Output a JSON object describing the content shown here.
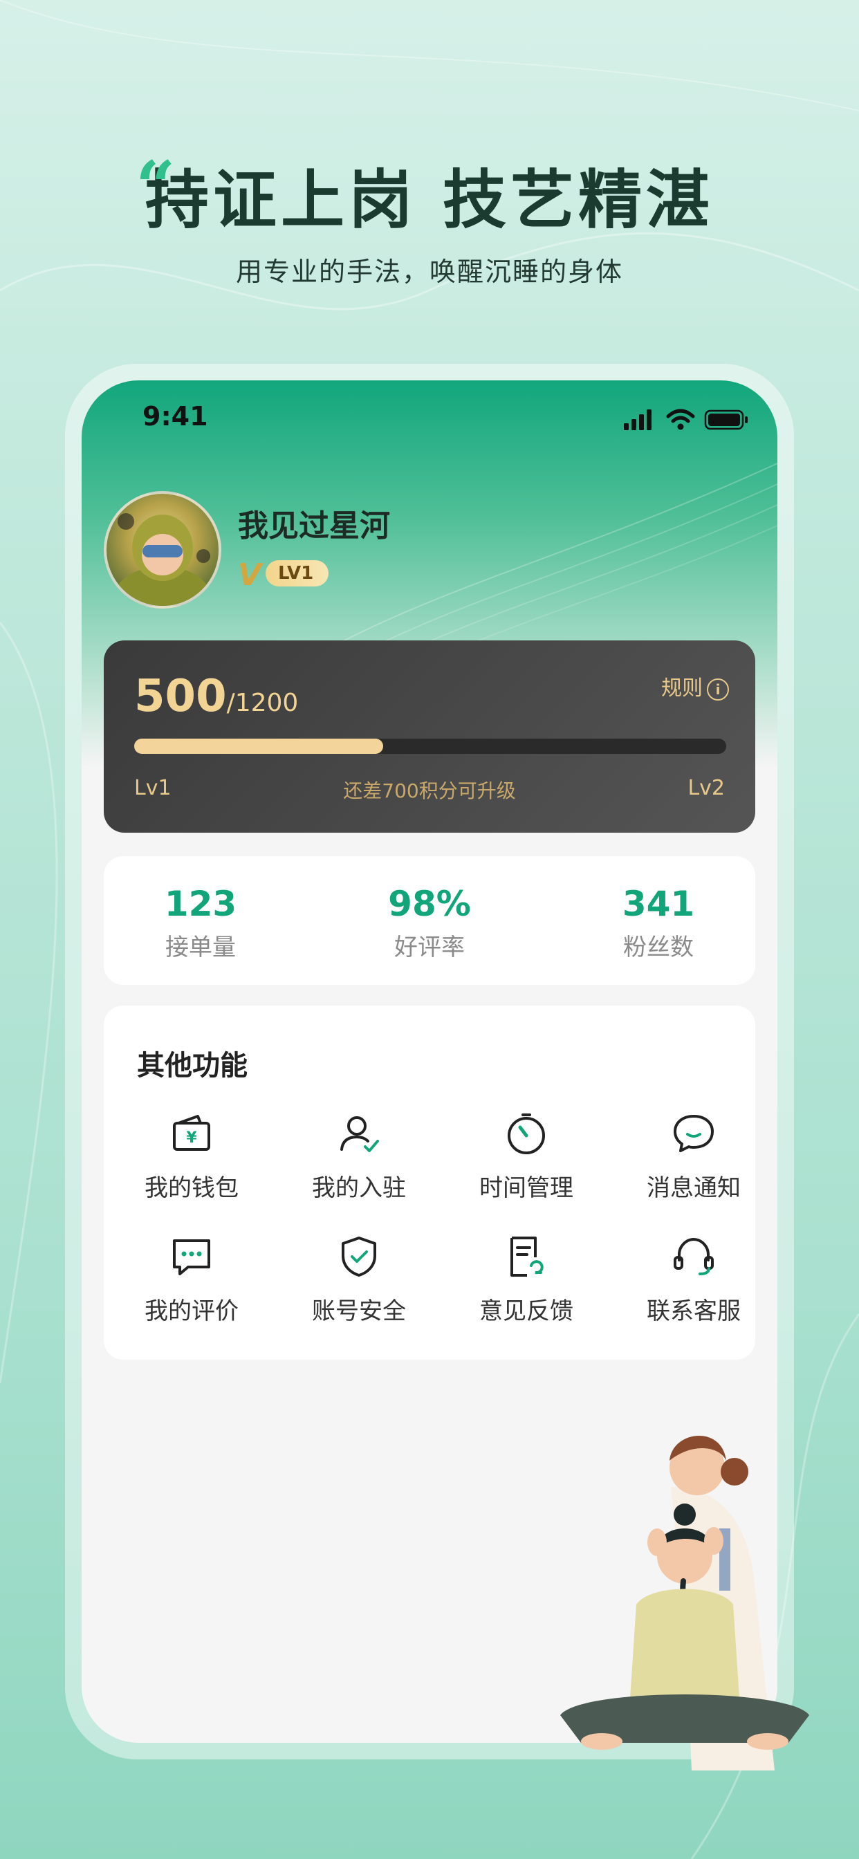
{
  "headline": {
    "quote_mark": "“",
    "title": "持证上岗 技艺精湛",
    "subtitle": "用专业的手法，唤醒沉睡的身体"
  },
  "status_bar": {
    "time": "9:41",
    "icons": [
      "signal-icon",
      "wifi-icon",
      "battery-icon"
    ]
  },
  "profile": {
    "username": "我见过星河",
    "level_mark": "V",
    "level_badge": "LV1"
  },
  "score_card": {
    "points": "500",
    "points_total": "/1200",
    "progress": 0.42,
    "rules_label": "规则",
    "current_level": "Lv1",
    "next_level": "Lv2",
    "upgrade_hint": "还差700积分可升级"
  },
  "stats": [
    {
      "value": "123",
      "label": "接单量"
    },
    {
      "value": "98%",
      "label": "好评率"
    },
    {
      "value": "341",
      "label": "粉丝数"
    }
  ],
  "functions": {
    "title": "其他功能",
    "items": [
      {
        "label": "我的钱包",
        "icon": "wallet-icon"
      },
      {
        "label": "我的入驻",
        "icon": "user-check-icon"
      },
      {
        "label": "时间管理",
        "icon": "timer-icon"
      },
      {
        "label": "消息通知",
        "icon": "message-bubble-icon"
      },
      {
        "label": "我的评价",
        "icon": "comment-icon"
      },
      {
        "label": "账号安全",
        "icon": "shield-icon"
      },
      {
        "label": "意见反馈",
        "icon": "feedback-doc-icon"
      },
      {
        "label": "联系客服",
        "icon": "headset-icon"
      }
    ]
  },
  "colors": {
    "accent_green": "#11a579",
    "gold": "#f2d495",
    "dark_card": "#3a3a3a"
  }
}
